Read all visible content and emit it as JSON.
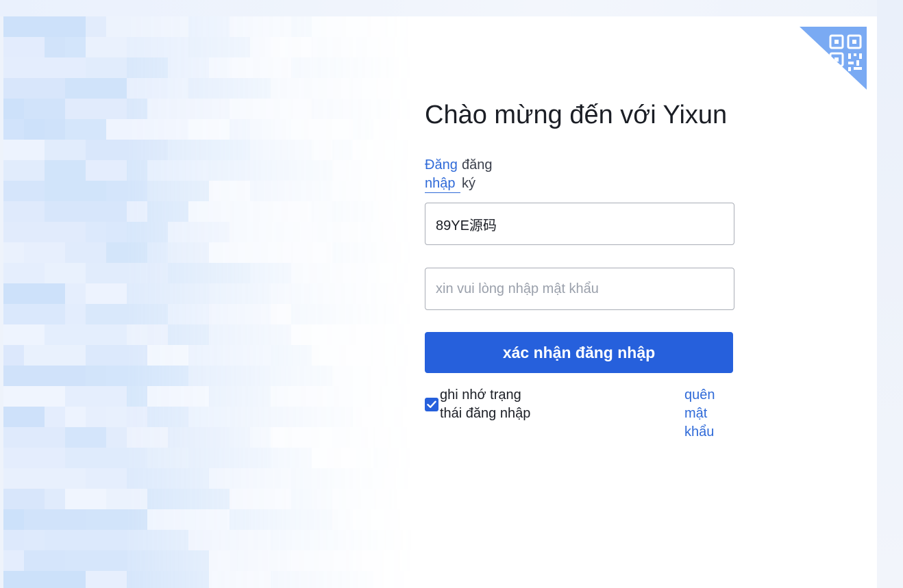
{
  "login": {
    "title": "Chào mừng đến với Yixun",
    "tabs": {
      "login": "Đăng nhập",
      "register": "đăng ký"
    },
    "username": {
      "value": "89YE源码"
    },
    "password": {
      "placeholder": "xin vui lòng nhập mật khẩu",
      "value": ""
    },
    "submit_label": "xác nhận đăng nhập",
    "remember": {
      "label": "ghi nhớ trạng thái đăng nhập",
      "checked": true
    },
    "forgot_label": "quên mật khẩu"
  },
  "icons": {
    "qr_login": "qr-code-icon",
    "checkbox": "checkmark-icon"
  },
  "colors": {
    "accent": "#2660dc",
    "link": "#2f6ad8",
    "qr_corner": "#7aaaf3"
  }
}
